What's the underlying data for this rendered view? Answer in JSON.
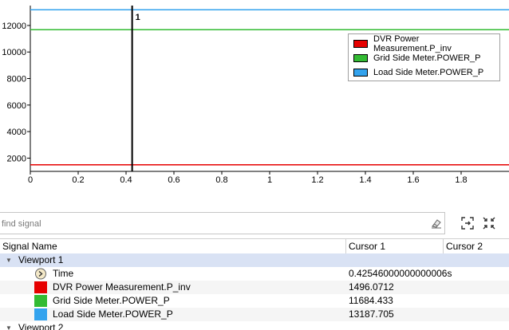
{
  "chart_data": {
    "type": "line",
    "xlim": [
      0,
      2.0
    ],
    "ylim": [
      1000,
      13500
    ],
    "x_ticks": [
      0,
      0.2,
      0.4,
      0.6,
      0.8,
      1,
      1.2,
      1.4,
      1.6,
      1.8
    ],
    "x_tick_labels": [
      "0",
      "0.2",
      "0.4",
      "0.6",
      "0.8",
      "1",
      "1.2",
      "1.4",
      "1.6",
      "1.8"
    ],
    "y_ticks": [
      2000,
      4000,
      6000,
      8000,
      10000,
      12000
    ],
    "y_tick_labels": [
      "2000",
      "4000",
      "6000",
      "8000",
      "10000",
      "12000"
    ],
    "series": [
      {
        "name": "DVR Power Measurement.P_inv",
        "color": "#e60000",
        "x": [
          0,
          2.0
        ],
        "y": [
          1496.0712,
          1496.0712
        ]
      },
      {
        "name": "Grid Side Meter.POWER_P",
        "color": "#33bb33",
        "x": [
          0,
          2.0
        ],
        "y": [
          11684.433,
          11684.433
        ]
      },
      {
        "name": "Load Side Meter.POWER_P",
        "color": "#33a3ee",
        "x": [
          0,
          2.0
        ],
        "y": [
          13187.705,
          13187.705
        ]
      }
    ],
    "cursor": {
      "label": "1",
      "x": 0.42546
    },
    "legend_position": "top-right",
    "grid": false
  },
  "legend": {
    "items": [
      {
        "label": "DVR Power Measurement.P_inv",
        "color": "#e60000"
      },
      {
        "label": "Grid Side Meter.POWER_P",
        "color": "#33bb33"
      },
      {
        "label": "Load Side Meter.POWER_P",
        "color": "#33a3ee"
      }
    ]
  },
  "search": {
    "placeholder": "find signal",
    "clear_icon": "eraser-icon",
    "tool1_icon": "fit-expand-icon",
    "tool2_icon": "fit-collapse-icon"
  },
  "table": {
    "columns": [
      "Signal Name",
      "Cursor 1",
      "Cursor 2"
    ],
    "viewport1": "Viewport 1",
    "viewport2": "Viewport 2",
    "rows": [
      {
        "name": "Time",
        "cursor1": "0.42546000000000006s",
        "cursor2": "",
        "icon": "clock-icon"
      },
      {
        "name": "DVR Power Measurement.P_inv",
        "cursor1": "1496.0712",
        "cursor2": "",
        "color": "#e60000"
      },
      {
        "name": "Grid Side Meter.POWER_P",
        "cursor1": "11684.433",
        "cursor2": "",
        "color": "#33bb33"
      },
      {
        "name": "Load Side Meter.POWER_P",
        "cursor1": "13187.705",
        "cursor2": "",
        "color": "#33a3ee"
      }
    ]
  }
}
